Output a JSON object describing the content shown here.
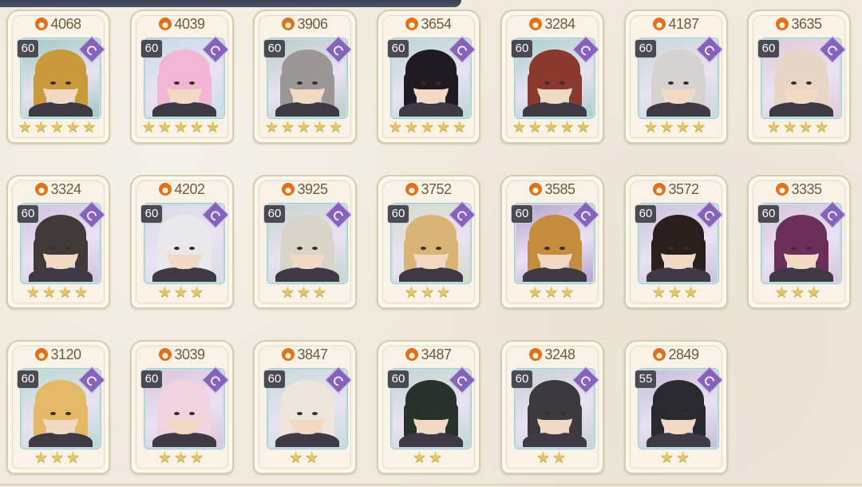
{
  "colors": {
    "accent_flame": "#e0701c",
    "level_badge": "#4a4a52",
    "class_badge": "#8463b8",
    "star": "#e3c56a"
  },
  "heroes": [
    {
      "power": "4068",
      "level": "60",
      "stars": 5,
      "hair": "#c99a3c",
      "bg": "#9fc9c0"
    },
    {
      "power": "4039",
      "level": "60",
      "stars": 5,
      "hair": "#f1b6d4",
      "bg": "#c8dcea"
    },
    {
      "power": "3906",
      "level": "60",
      "stars": 5,
      "hair": "#9a9794",
      "bg": "#b9cdc5"
    },
    {
      "power": "3654",
      "level": "60",
      "stars": 5,
      "hair": "#1e1c22",
      "bg": "#bcd6d0"
    },
    {
      "power": "3284",
      "level": "60",
      "stars": 5,
      "hair": "#8a3a2c",
      "bg": "#a9d0c8"
    },
    {
      "power": "4187",
      "level": "60",
      "stars": 4,
      "hair": "#d5d3d0",
      "bg": "#c9d8d8"
    },
    {
      "power": "3635",
      "level": "60",
      "stars": 4,
      "hair": "#e7d6c6",
      "bg": "#e5c9d6"
    },
    {
      "power": "3324",
      "level": "60",
      "stars": 4,
      "hair": "#403b38",
      "bg": "#cfc2e0"
    },
    {
      "power": "4202",
      "level": "60",
      "stars": 3,
      "hair": "#e9e9ec",
      "bg": "#d8dce4"
    },
    {
      "power": "3925",
      "level": "60",
      "stars": 3,
      "hair": "#d9d4c8",
      "bg": "#c7d4cf"
    },
    {
      "power": "3752",
      "level": "60",
      "stars": 3,
      "hair": "#d9b476",
      "bg": "#d6dcc6"
    },
    {
      "power": "3585",
      "level": "60",
      "stars": 3,
      "hair": "#c58c3e",
      "bg": "#b7a2d0"
    },
    {
      "power": "3572",
      "level": "60",
      "stars": 3,
      "hair": "#2a1f1c",
      "bg": "#c9c2da"
    },
    {
      "power": "3335",
      "level": "60",
      "stars": 3,
      "hair": "#6c2f5c",
      "bg": "#d7c4dc"
    },
    {
      "power": "3120",
      "level": "60",
      "stars": 3,
      "hair": "#e3b866",
      "bg": "#b9d9cf"
    },
    {
      "power": "3039",
      "level": "60",
      "stars": 3,
      "hair": "#f0d2e0",
      "bg": "#dcc4dc"
    },
    {
      "power": "3847",
      "level": "60",
      "stars": 2,
      "hair": "#ece7da",
      "bg": "#c6dcd8"
    },
    {
      "power": "3487",
      "level": "60",
      "stars": 2,
      "hair": "#26322a",
      "bg": "#c2d6cf"
    },
    {
      "power": "3248",
      "level": "60",
      "stars": 2,
      "hair": "#3c3a3d",
      "bg": "#c8d2d2"
    },
    {
      "power": "2849",
      "level": "55",
      "stars": 2,
      "hair": "#2a2930",
      "bg": "#c4bcd6"
    }
  ]
}
